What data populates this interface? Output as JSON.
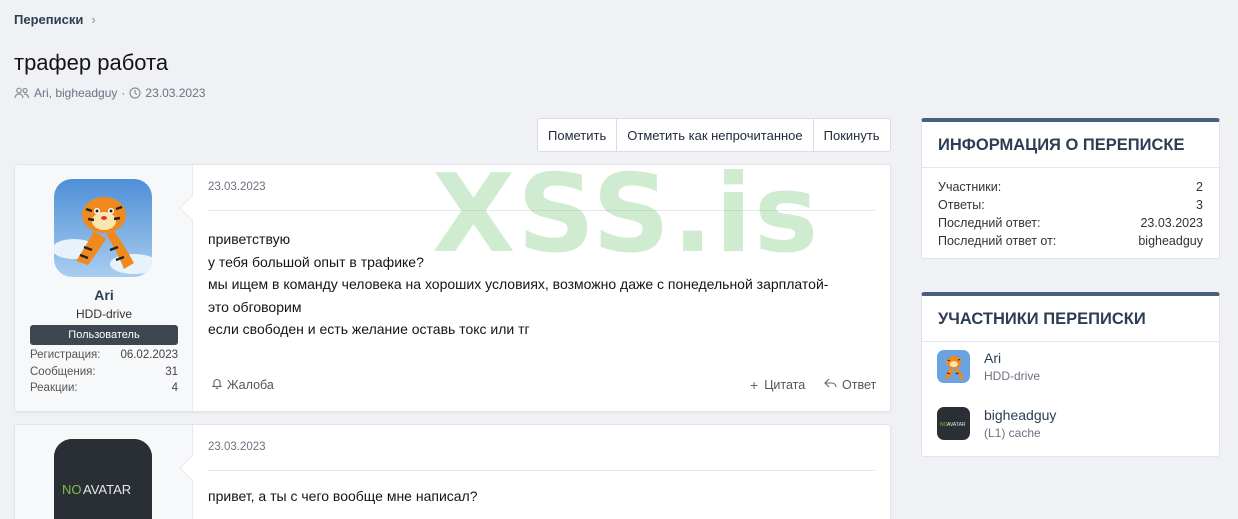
{
  "breadcrumb": {
    "label": "Переписки",
    "chevron": "›"
  },
  "thread": {
    "title": "трафер работа",
    "participants": "Ari, bigheadguy",
    "separator": "·",
    "date": "23.03.2023"
  },
  "toolbar": {
    "mark": "Пометить",
    "mark_unread": "Отметить как непрочитанное",
    "leave": "Покинуть"
  },
  "watermark": "XSS.is",
  "posts": [
    {
      "username": "Ari",
      "user_title": "HDD-drive",
      "role": "Пользователь",
      "stats": [
        {
          "label": "Регистрация:",
          "value": "06.02.2023"
        },
        {
          "label": "Сообщения:",
          "value": "31"
        },
        {
          "label": "Реакции:",
          "value": "4"
        }
      ],
      "date": "23.03.2023",
      "lines": [
        "приветствую",
        "у тебя большой опыт в трафике?",
        "мы ищем в команду человека на хороших условиях, возможно даже с понедельной зарплатой-",
        "это обговорим",
        "если свободен и есть желание оставь токс или тг"
      ],
      "report": "Жалоба",
      "quote": "Цитата",
      "reply": "Ответ"
    },
    {
      "avatar_text_a": "NO",
      "avatar_text_b": "AVATAR",
      "date": "23.03.2023",
      "lines": [
        "привет, а ты с чего вообще мне написал?"
      ]
    }
  ],
  "info_box": {
    "title": "ИНФОРМАЦИЯ О ПЕРЕПИСКЕ",
    "rows": [
      {
        "label": "Участники:",
        "value": "2"
      },
      {
        "label": "Ответы:",
        "value": "3"
      },
      {
        "label": "Последний ответ:",
        "value": "23.03.2023"
      },
      {
        "label": "Последний ответ от:",
        "value": "bigheadguy"
      }
    ]
  },
  "participants_box": {
    "title": "УЧАСТНИКИ ПЕРЕПИСКИ",
    "items": [
      {
        "name": "Ari",
        "desc": "HDD-drive"
      },
      {
        "name": "bigheadguy",
        "desc": "(L1) cache",
        "avatar_a": "NO",
        "avatar_b": "AVATAR"
      }
    ]
  },
  "colors": {
    "accent": "#2c3e55",
    "box_top": "#47607e",
    "watermark": "#78c878",
    "role_bg": "#3d4651"
  },
  "icons": [
    "chevron-right-icon",
    "users-icon",
    "clock-icon",
    "bell-icon",
    "plus-icon",
    "reply-icon"
  ]
}
